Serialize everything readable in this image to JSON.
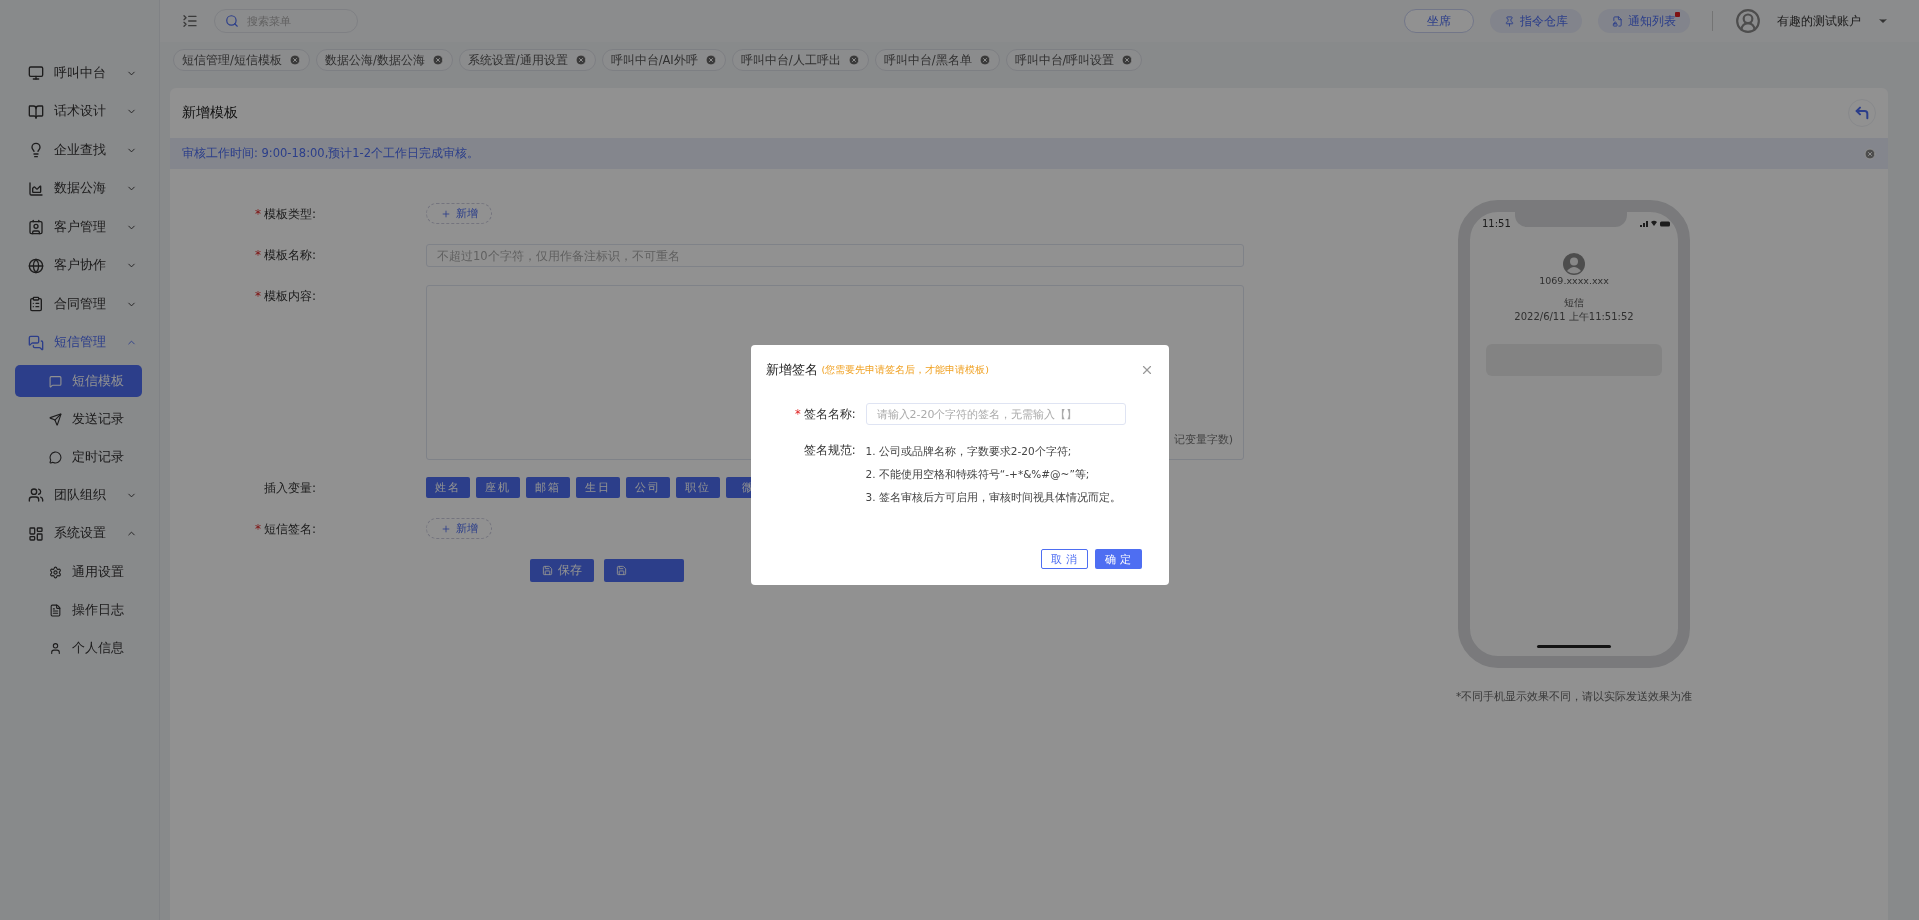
{
  "topbar": {
    "search": {
      "placeholder": "搜索菜单"
    },
    "buttons": [
      {
        "label": "坐席",
        "kind": "outline",
        "badge": false
      },
      {
        "label": "指令仓库",
        "kind": "filled",
        "badge": false
      },
      {
        "label": "通知列表",
        "kind": "filled",
        "badge": true
      }
    ],
    "account": "有趣的测试账户"
  },
  "sidebar": {
    "items": [
      {
        "label": "呼叫中台",
        "selected": false,
        "expanded": false
      },
      {
        "label": "话术设计",
        "selected": false,
        "expanded": false
      },
      {
        "label": "企业查找",
        "selected": false,
        "expanded": false
      },
      {
        "label": "数据公海",
        "selected": false,
        "expanded": false
      },
      {
        "label": "客户管理",
        "selected": false,
        "expanded": false
      },
      {
        "label": "客户协作",
        "selected": false,
        "expanded": false
      },
      {
        "label": "合同管理",
        "selected": false,
        "expanded": false
      },
      {
        "label": "短信管理",
        "selected": true,
        "expanded": true,
        "children": [
          {
            "label": "短信模板",
            "selected": true
          },
          {
            "label": "发送记录",
            "selected": false
          },
          {
            "label": "定时记录",
            "selected": false
          }
        ]
      },
      {
        "label": "团队组织",
        "selected": false,
        "expanded": false
      },
      {
        "label": "系统设置",
        "selected": false,
        "expanded": true,
        "children": [
          {
            "label": "通用设置",
            "selected": false
          },
          {
            "label": "操作日志",
            "selected": false
          },
          {
            "label": "个人信息",
            "selected": false
          }
        ]
      }
    ]
  },
  "tabs": [
    {
      "label": "短信管理/短信模板"
    },
    {
      "label": "数据公海/数据公海"
    },
    {
      "label": "系统设置/通用设置"
    },
    {
      "label": "呼叫中台/AI外呼"
    },
    {
      "label": "呼叫中台/人工呼出"
    },
    {
      "label": "呼叫中台/黑名单"
    },
    {
      "label": "呼叫中台/呼叫设置"
    }
  ],
  "card": {
    "title": "新增模板",
    "notice": "审核工作时间: 9:00-18:00,预计1-2个工作日完成审核。"
  },
  "form": {
    "fields": [
      {
        "kind": "add",
        "mark": "*",
        "label": "模板类型:",
        "button": "新增"
      },
      {
        "kind": "input",
        "mark": "*",
        "label": "模板名称:",
        "placeholder": "不超过10个字符，仅用作备注标识，不可重名"
      },
      {
        "kind": "textarea",
        "mark": "*",
        "label": "模板内容:",
        "hint": "记变量字数)"
      },
      {
        "kind": "chips",
        "label": "插入变量:",
        "chips": [
          "姓名",
          "座机",
          "邮箱",
          "生日",
          "公司",
          "职位",
          "微"
        ]
      },
      {
        "kind": "add",
        "mark": "*",
        "label": "短信签名:",
        "button": "新增"
      }
    ],
    "actions": [
      {
        "kind": "labeled",
        "label": "保存"
      },
      {
        "kind": "covered"
      }
    ]
  },
  "phone": {
    "time": "11:51",
    "sender": "1069.xxxx.xxx",
    "label": "短信",
    "datetime": "2022/6/11 上午11:51:52",
    "caption": "*不同手机显示效果不同，请以实际发送效果为准"
  },
  "modal": {
    "title": "新增签名",
    "note": "(您需要先申请签名后，才能申请模板)",
    "field": {
      "mark": "*",
      "label": "签名名称:",
      "placeholder": "请输入2-20个字符的签名，无需输入【】"
    },
    "rules_label": "签名规范:",
    "rules": [
      "1. 公司或品牌名称，字数要求2-20个字符;",
      "2. 不能使用空格和特殊符号“-+*&%#@~”等;",
      "3. 签名审核后方可启用，审核时间视具体情况而定。"
    ],
    "buttons": [
      {
        "label": "取 消",
        "kind": "secondary"
      },
      {
        "label": "确 定",
        "kind": "primary"
      }
    ]
  }
}
